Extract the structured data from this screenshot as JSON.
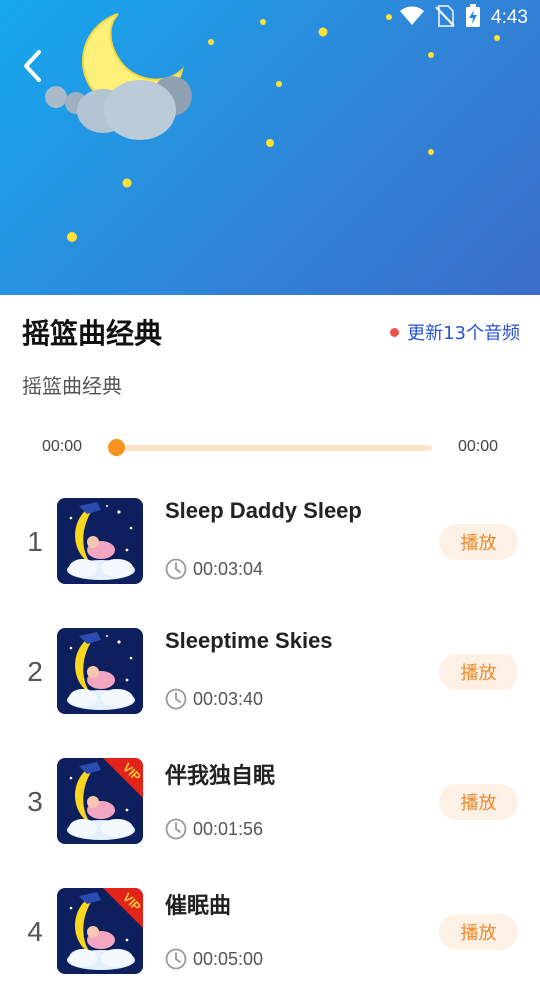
{
  "status_bar": {
    "time": "4:43",
    "icons": [
      "wifi-icon",
      "no-sim-icon",
      "battery-charging-icon"
    ]
  },
  "header": {
    "back_icon": "back-arrow-icon",
    "illustration": "night-sky-moon-cloud"
  },
  "album": {
    "title": "摇篮曲经典",
    "subtitle": "摇篮曲经典",
    "update_text": "更新13个音频",
    "update_dot_color": "#ef5350"
  },
  "player": {
    "current_time": "00:00",
    "total_time": "00:00",
    "progress": 0
  },
  "songs": [
    {
      "index": "1",
      "title": "Sleep Daddy  Sleep",
      "duration": "00:03:04",
      "play_label": "播放",
      "vip": false
    },
    {
      "index": "2",
      "title": "Sleeptime Skies",
      "duration": "00:03:40",
      "play_label": "播放",
      "vip": false
    },
    {
      "index": "3",
      "title": "伴我独自眠",
      "duration": "00:01:56",
      "play_label": "播放",
      "vip": true
    },
    {
      "index": "4",
      "title": "催眠曲",
      "duration": "00:05:00",
      "play_label": "播放",
      "vip": true
    }
  ],
  "vip_badge": "VIP",
  "colors": {
    "accent": "#f7931e",
    "play_button_text": "#f0892b",
    "update_text": "#2653d9"
  }
}
